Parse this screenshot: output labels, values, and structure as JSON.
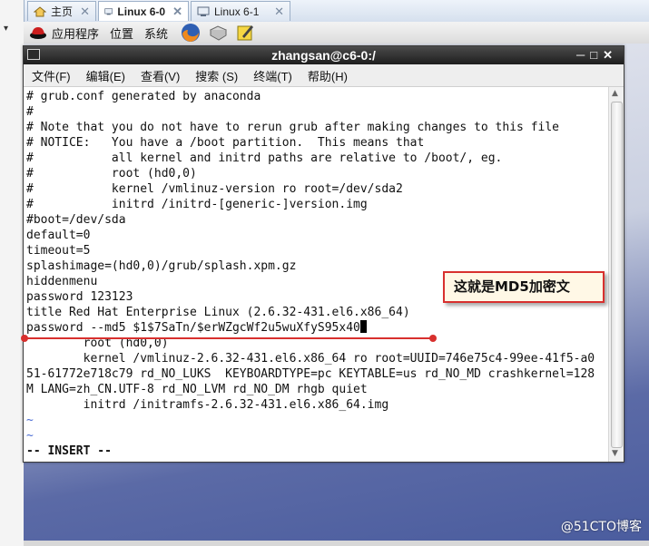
{
  "tabs": [
    {
      "label": "主页",
      "active": false
    },
    {
      "label": "Linux 6-0",
      "active": true
    },
    {
      "label": "Linux 6-1",
      "active": false
    }
  ],
  "panel": {
    "applications": "应用程序",
    "places": "位置",
    "system": "系统"
  },
  "terminal": {
    "title": "zhangsan@c6-0:/",
    "menu": [
      "文件(F)",
      "编辑(E)",
      "查看(V)",
      "搜索 (S)",
      "终端(T)",
      "帮助(H)"
    ],
    "lines": [
      "# grub.conf generated by anaconda",
      "#",
      "# Note that you do not have to rerun grub after making changes to this file",
      "# NOTICE:   You have a /boot partition.  This means that",
      "#           all kernel and initrd paths are relative to /boot/, eg.",
      "#           root (hd0,0)",
      "#           kernel /vmlinuz-version ro root=/dev/sda2",
      "#           initrd /initrd-[generic-]version.img",
      "#boot=/dev/sda",
      "default=0",
      "timeout=5",
      "splashimage=(hd0,0)/grub/splash.xpm.gz",
      "hiddenmenu",
      "password 123123",
      "title Red Hat Enterprise Linux (2.6.32-431.el6.x86_64)",
      "password --md5 $1$7SaTn/$erWZgcWf2u5wuXfyS95x40",
      "        root (hd0,0)",
      "        kernel /vmlinuz-2.6.32-431.el6.x86_64 ro root=UUID=746e75c4-99ee-41f5-a0",
      "51-61772e718c79 rd_NO_LUKS  KEYBOARDTYPE=pc KEYTABLE=us rd_NO_MD crashkernel=128",
      "M LANG=zh_CN.UTF-8 rd_NO_LVM rd_NO_DM rhgb quiet",
      "        initrd /initramfs-2.6.32-431.el6.x86_64.img",
      "~",
      "~",
      "",
      "-- INSERT --"
    ]
  },
  "annotation": {
    "text": "这就是MD5加密文",
    "color": "#d8302e"
  },
  "watermark": "@51CTO博客",
  "colors": {
    "accent_red": "#d8302e",
    "vim_tilde": "#4a6cd4"
  }
}
